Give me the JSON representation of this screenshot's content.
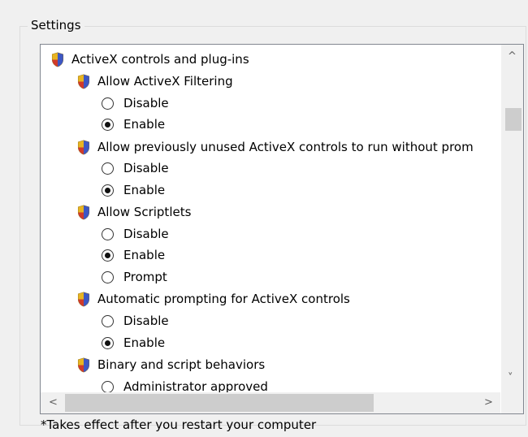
{
  "group": {
    "label": "Settings"
  },
  "tree": {
    "category": "ActiveX controls and plug-ins",
    "settings": [
      {
        "title": "Allow ActiveX Filtering",
        "options": [
          {
            "label": "Disable",
            "checked": false
          },
          {
            "label": "Enable",
            "checked": true
          }
        ]
      },
      {
        "title": "Allow previously unused ActiveX controls to run without prom",
        "options": [
          {
            "label": "Disable",
            "checked": false
          },
          {
            "label": "Enable",
            "checked": true
          }
        ]
      },
      {
        "title": "Allow Scriptlets",
        "options": [
          {
            "label": "Disable",
            "checked": false
          },
          {
            "label": "Enable",
            "checked": true
          },
          {
            "label": "Prompt",
            "checked": false
          }
        ]
      },
      {
        "title": "Automatic prompting for ActiveX controls",
        "options": [
          {
            "label": "Disable",
            "checked": false
          },
          {
            "label": "Enable",
            "checked": true
          }
        ]
      },
      {
        "title": "Binary and script behaviors",
        "options": [
          {
            "label": "Administrator approved",
            "checked": false
          }
        ]
      }
    ]
  },
  "scrollbar": {
    "up_glyph": "^",
    "down_glyph": "˅",
    "left_glyph": "<",
    "right_glyph": ">"
  },
  "footer": {
    "note": "*Takes effect after you restart your computer"
  },
  "icons": {
    "setting": "shield-icon"
  },
  "colors": {
    "shield_blue": "#3d57c4",
    "shield_gold": "#e8b422",
    "shield_red": "#d03a2a"
  }
}
